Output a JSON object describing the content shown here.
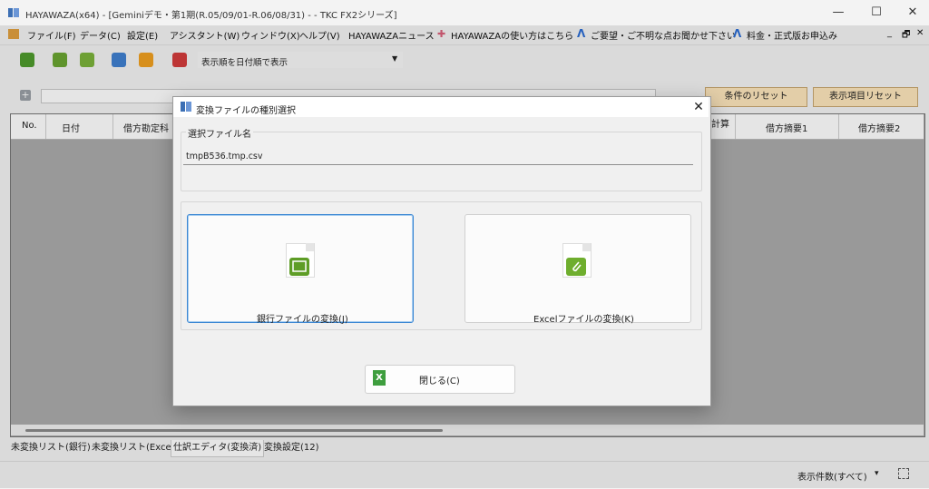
{
  "window": {
    "title": "HAYAWAZA(x64) - [Geminiデモ・第1期(R.05/09/01-R.06/08/31) - - TKC FX2シリーズ]",
    "controls": [
      "—",
      "☐",
      "✕"
    ]
  },
  "menu": {
    "items": [
      "ファイル(F)",
      "データ(C)",
      "設定(E)",
      "アシスタント(W)",
      "ウィンドウ(X)",
      "ヘルプ(V)",
      "HAYAWAZAニュース",
      "HAYAWAZAの使い方はこちら",
      "ご要望・ご不明な点お聞かせ下さい",
      "料金・正式版お申込み"
    ],
    "right_controls": [
      "_",
      "🗗",
      "✕"
    ]
  },
  "toolbar": {
    "sort_option": "表示順を日付順で表示"
  },
  "filter": {
    "plus": "+",
    "reset_conditions": "条件のリセット",
    "reset_columns": "表示項目リセット"
  },
  "grid": {
    "columns": [
      "No.",
      "日付",
      "借方勘定科",
      "計算",
      "借方摘要1",
      "借方摘要2"
    ]
  },
  "tabs": [
    "未変換リスト(銀行)",
    "未変換リスト(Excel)",
    "仕訳エディタ(変換済)",
    "変換設定(12)"
  ],
  "status": {
    "count_label": "表示件数(すべて)",
    "caret": "▾"
  },
  "dialog": {
    "title": "変換ファイルの種別選択",
    "close": "✕",
    "file_group_label": "選択ファイル名",
    "file_name": "tmpB536.tmp.csv",
    "bank_button": "銀行ファイルの変換(J)",
    "excel_button": "Excelファイルの変換(K)",
    "close_button": "閉じる(C)"
  },
  "colors": {
    "accent_green": "#5e9d26",
    "orange_button": "#fde6bb",
    "focus_blue": "#3b87d3"
  }
}
